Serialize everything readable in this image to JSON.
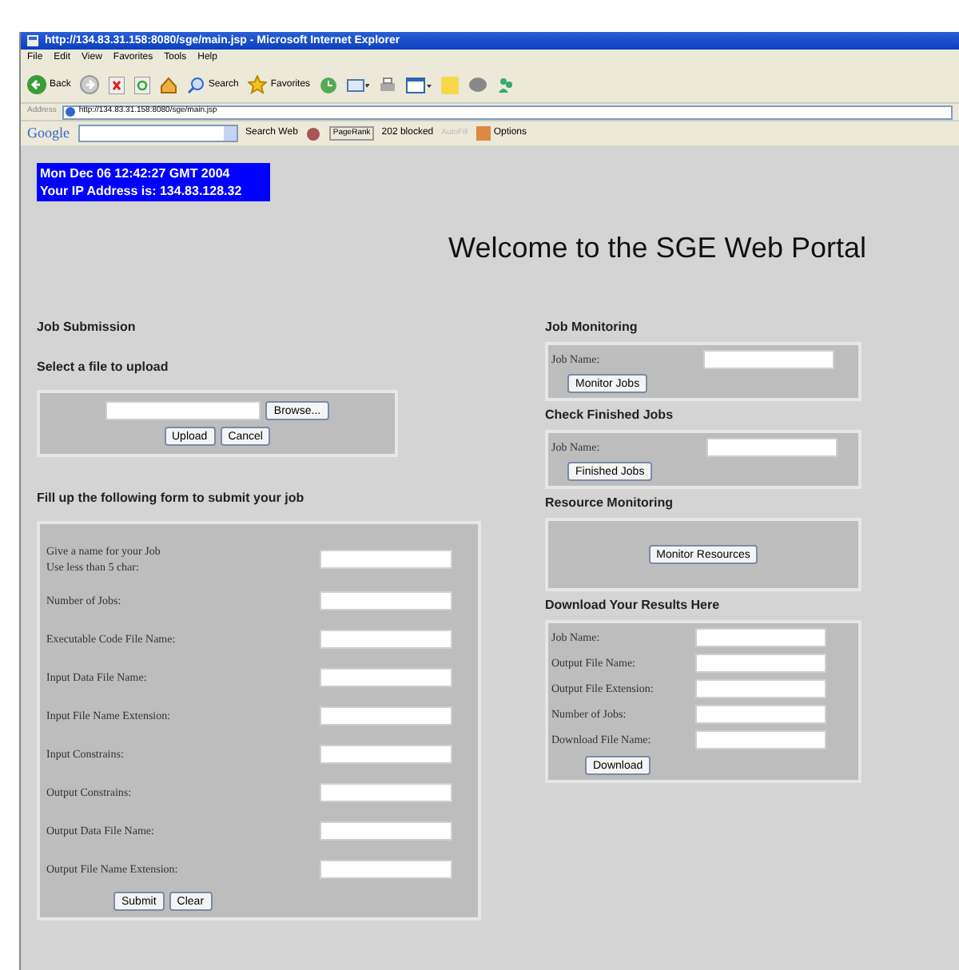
{
  "window": {
    "title": "http://134.83.31.158:8080/sge/main.jsp - Microsoft Internet Explorer"
  },
  "menu": [
    "File",
    "Edit",
    "View",
    "Favorites",
    "Tools",
    "Help"
  ],
  "toolbar": {
    "back": "Back",
    "search": "Search",
    "favorites": "Favorites"
  },
  "address_bar": {
    "label": "Address",
    "url": "http://134.83.31.158:8080/sge/main.jsp"
  },
  "google_bar": {
    "logo": "Google",
    "search_web": "Search Web",
    "pagerank": "PageRank",
    "blocked": "202 blocked",
    "autofill": "AutoFill",
    "autofill_disabled": true,
    "options": "Options"
  },
  "info_box": {
    "date": "Mon Dec 06 12:42:27 GMT 2004",
    "ip": "Your IP Address is: 134.83.128.32"
  },
  "heading": "Welcome to the SGE Web Portal",
  "job_submission": {
    "title": "Job Submission",
    "upload_title": "Select a file to upload",
    "browse": "Browse...",
    "upload": "Upload",
    "cancel": "Cancel",
    "form_title": "Fill up the following form to submit your job",
    "fields": [
      {
        "label": "Give a name for your Job\nUse less than 5 char:"
      },
      {
        "label": "Number of Jobs:"
      },
      {
        "label": "Executable Code File Name:"
      },
      {
        "label": "Input Data File Name:"
      },
      {
        "label": "Input File Name Extension:"
      },
      {
        "label": "Input Constrains:"
      },
      {
        "label": "Output Constrains:"
      },
      {
        "label": "Output Data File Name:"
      },
      {
        "label": "Output File Name Extension:"
      }
    ],
    "buttons": [
      "Submit",
      "Clear"
    ]
  },
  "job_monitoring": {
    "title": "Job Monitoring",
    "field": "Job Name:",
    "button": "Monitor Jobs"
  },
  "finished_jobs": {
    "title": "Check Finished Jobs",
    "field": "Job Name:",
    "button": "Finished Jobs"
  },
  "resource_monitoring": {
    "title": "Resource Monitoring",
    "button": "Monitor Resources"
  },
  "download": {
    "title": "Download Your Results Here",
    "fields": [
      "Job Name:",
      "Output File Name:",
      "Output File Extension:",
      "Number of Jobs:",
      "Download File Name:"
    ],
    "button": "Download"
  }
}
